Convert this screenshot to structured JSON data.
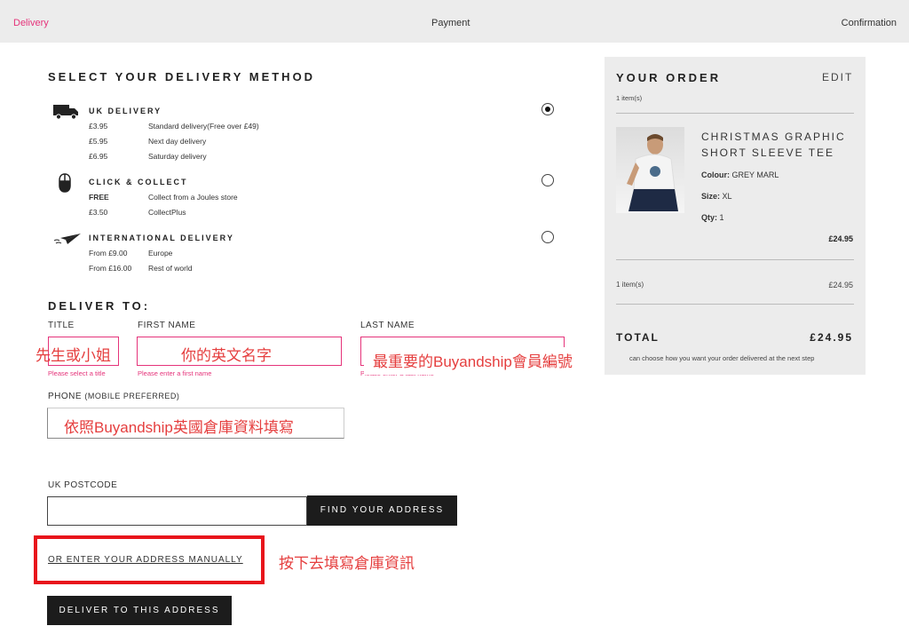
{
  "steps": {
    "delivery": "Delivery",
    "payment": "Payment",
    "confirmation": "Confirmation"
  },
  "delivery": {
    "title": "SELECT YOUR DELIVERY METHOD",
    "methods": [
      {
        "name": "UK DELIVERY",
        "icon": "truck-icon",
        "options": [
          {
            "price": "£3.95",
            "desc": "Standard delivery(Free over £49)"
          },
          {
            "price": "£5.95",
            "desc": "Next day delivery"
          },
          {
            "price": "£6.95",
            "desc": "Saturday delivery"
          }
        ],
        "selected": true
      },
      {
        "name": "CLICK & COLLECT",
        "icon": "mouse-icon",
        "options": [
          {
            "price": "FREE",
            "desc": "Collect from a Joules store"
          },
          {
            "price": "£3.50",
            "desc": "CollectPlus"
          }
        ],
        "selected": false
      },
      {
        "name": "INTERNATIONAL DELIVERY",
        "icon": "paper-plane-icon",
        "options": [
          {
            "price": "From £9.00",
            "desc": "Europe"
          },
          {
            "price": "From £16.00",
            "desc": "Rest of world"
          }
        ],
        "selected": false
      }
    ]
  },
  "deliver_to": {
    "title": "DELIVER TO:",
    "title_label": "TITLE",
    "title_value": "先生或小姐",
    "title_error": "Please select a title",
    "first_name_label": "FIRST NAME",
    "first_name_value": "你的英文名字",
    "first_name_error": "Please enter a first name",
    "last_name_label": "LAST NAME",
    "last_name_value": "最重要的Buyandship會員編號",
    "last_name_error": "Please enter a last name",
    "phone_label": "PHONE",
    "phone_sub": "(MOBILE PREFERRED)",
    "phone_value": "依照Buyandship英國倉庫資料填寫",
    "postcode_label": "UK POSTCODE",
    "find_button": "FIND YOUR ADDRESS",
    "manual_link": "OR ENTER YOUR ADDRESS MANUALLY",
    "manual_annotation": "按下去填寫倉庫資訊",
    "deliver_button": "DELIVER TO THIS ADDRESS"
  },
  "order": {
    "title": "YOUR ORDER",
    "edit": "EDIT",
    "count": "1 item(s)",
    "product": {
      "name_line1": "CHRISTMAS GRAPHIC",
      "name_line2": "SHORT SLEEVE TEE",
      "colour_label": "Colour:",
      "colour": "GREY MARL",
      "size_label": "Size:",
      "size": "XL",
      "qty_label": "Qty:",
      "qty": "1",
      "price": "£24.95"
    },
    "subtotal_label": "1 item(s)",
    "subtotal": "£24.95",
    "total_label": "TOTAL",
    "total": "£24.95",
    "note": "can choose how you want your order delivered at the next step"
  },
  "colors": {
    "accent": "#e5337a",
    "annotation": "#e8141b",
    "button": "#1c1c1c"
  }
}
